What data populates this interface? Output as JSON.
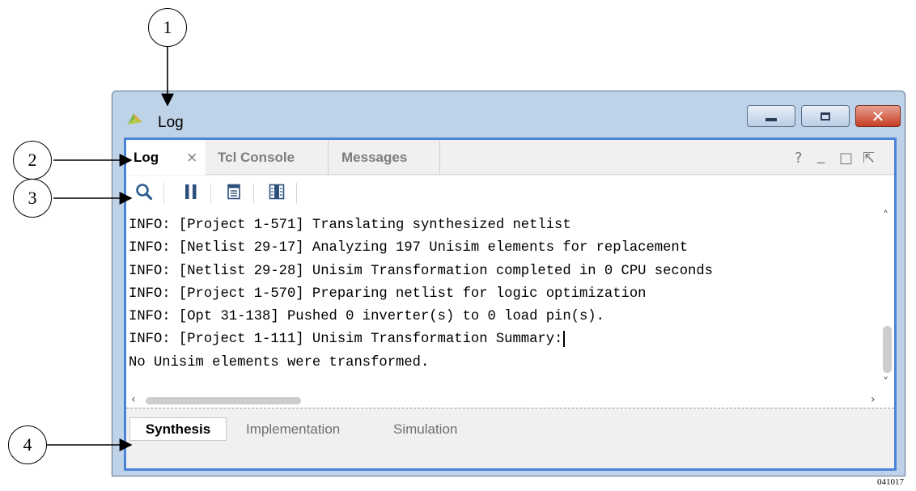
{
  "window": {
    "title": "Log",
    "controls": {
      "minimize": "minimize-icon",
      "maximize": "maximize-icon",
      "close": "close-icon"
    }
  },
  "tabs": [
    {
      "label": "Log",
      "active": true,
      "closable": true
    },
    {
      "label": "Tcl Console",
      "active": false
    },
    {
      "label": "Messages",
      "active": false
    }
  ],
  "panel_controls": [
    "?",
    "_",
    "□",
    "⇱"
  ],
  "toolbar": {
    "items": [
      "search-icon",
      "pause-icon",
      "copy-icon",
      "column-icon"
    ]
  },
  "log_lines": [
    "INFO: [Project 1-571] Translating synthesized netlist",
    "INFO: [Netlist 29-17] Analyzing 197 Unisim elements for replacement",
    "INFO: [Netlist 29-28] Unisim Transformation completed in 0 CPU seconds",
    "INFO: [Project 1-570] Preparing netlist for logic optimization",
    "INFO: [Opt 31-138] Pushed 0 inverter(s) to 0 load pin(s).",
    "INFO: [Project 1-111] Unisim Transformation Summary:",
    "No Unisim elements were transformed."
  ],
  "bottom_tabs": [
    {
      "label": "Synthesis",
      "active": true
    },
    {
      "label": "Implementation",
      "active": false
    },
    {
      "label": "Simulation",
      "active": false
    }
  ],
  "callouts": [
    "1",
    "2",
    "3",
    "4"
  ],
  "figure_id": "041017",
  "colors": {
    "panel_border": "#4a84d8",
    "close_button": "#c63f25"
  }
}
